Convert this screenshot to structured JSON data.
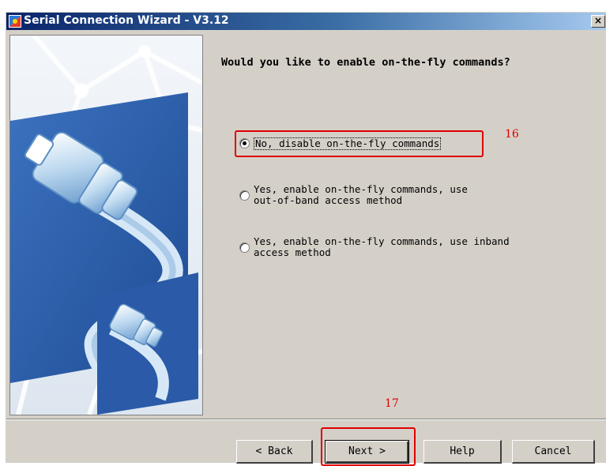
{
  "window": {
    "title": "Serial Connection Wizard - V3.12",
    "close_label": "×"
  },
  "page": {
    "question": "Would you like to enable on-the-fly commands?",
    "options": [
      {
        "label": "No, disable on-the-fly commands",
        "selected": true
      },
      {
        "label": "Yes, enable on-the-fly commands, use\nout-of-band access method",
        "selected": false
      },
      {
        "label": "Yes, enable on-the-fly commands, use inband\naccess method",
        "selected": false
      }
    ]
  },
  "annotations": {
    "option_marker": "16",
    "next_marker": "17",
    "color": "#e00000"
  },
  "buttons": {
    "back": "< Back",
    "next": "Next >",
    "help": "Help",
    "cancel": "Cancel"
  },
  "colors": {
    "title_bar": "#0a246a",
    "dialog_bg": "#d4d0c8",
    "illustration_blue": "#2a5aa8"
  },
  "icons": {
    "title": "wizard-app-icon",
    "illustration": "serial-cable-connector-illustration"
  }
}
